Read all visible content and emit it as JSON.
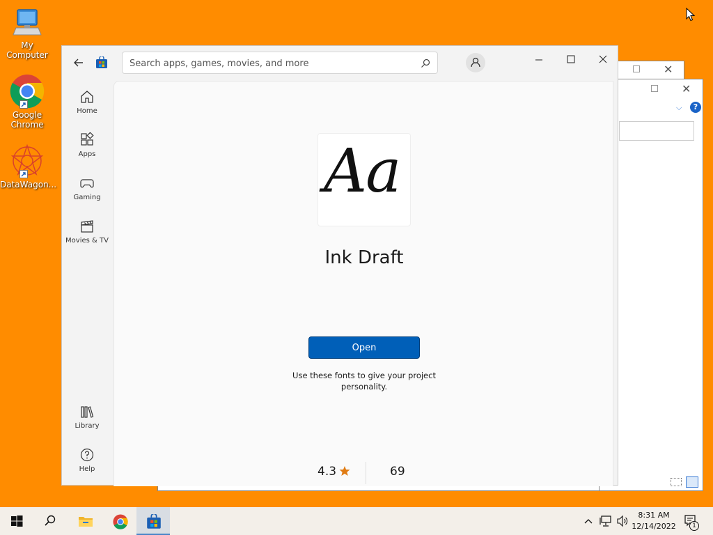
{
  "desktop": {
    "icons": [
      {
        "label": "My Computer"
      },
      {
        "label": "Google Chrome"
      },
      {
        "label": "DataWagon..."
      }
    ]
  },
  "store": {
    "search_placeholder": "Search apps, games, movies, and more",
    "nav": [
      {
        "label": "Home",
        "icon": "home-icon"
      },
      {
        "label": "Apps",
        "icon": "apps-icon"
      },
      {
        "label": "Gaming",
        "icon": "gamepad-icon"
      },
      {
        "label": "Movies & TV",
        "icon": "clapperboard-icon"
      },
      {
        "label": "Library",
        "icon": "library-icon"
      },
      {
        "label": "Help",
        "icon": "help-icon"
      }
    ],
    "app": {
      "logo_text": "Aa",
      "name": "Ink Draft",
      "open_label": "Open",
      "description": "Use these fonts to give your project personality.",
      "rating": "4.3",
      "rating_count": "69"
    },
    "colors": {
      "accent": "#005fb8",
      "star": "#e07b12"
    }
  },
  "taskbar": {
    "time": "8:31 AM",
    "date": "12/14/2022",
    "notification_count": "1"
  }
}
